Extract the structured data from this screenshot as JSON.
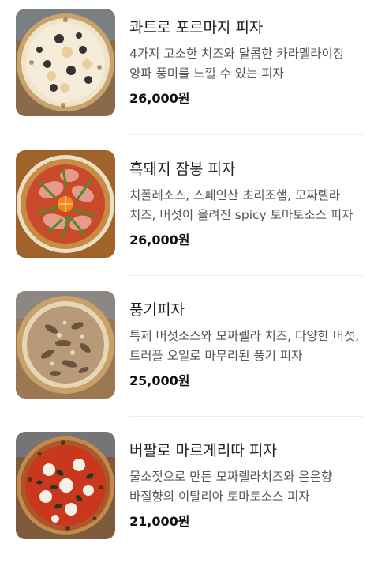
{
  "menu": {
    "items": [
      {
        "name": "콰트로 포르마지 피자",
        "description": "4가지 고소한 치즈와 달콤한 카라멜라이징 양파 풍미를 느낄 수 있는 피자",
        "price": "26,000원"
      },
      {
        "name": "흑돼지 잠봉 피자",
        "description": "치폴레소스, 스페인산 초리조햄, 모짜렐라 치즈, 버섯이 올려진 spicy 토마토소스 피자",
        "price": "26,000원"
      },
      {
        "name": "풍기피자",
        "description": "특제 버섯소스와 모짜렐라 치즈, 다양한 버섯, 트러플 오일로 마무리된 풍기 피자",
        "price": "25,000원"
      },
      {
        "name": "버팔로 마르게리따 피자",
        "description": "물소젖으로 만든 모짜렐라치즈와 은은향 바질향의 이탈리아 토마토소스 피자",
        "price": "21,000원"
      }
    ]
  },
  "colors": {
    "name_text": "#222222",
    "description_text": "#555555",
    "price_text": "#111111",
    "divider": "#ececec"
  }
}
